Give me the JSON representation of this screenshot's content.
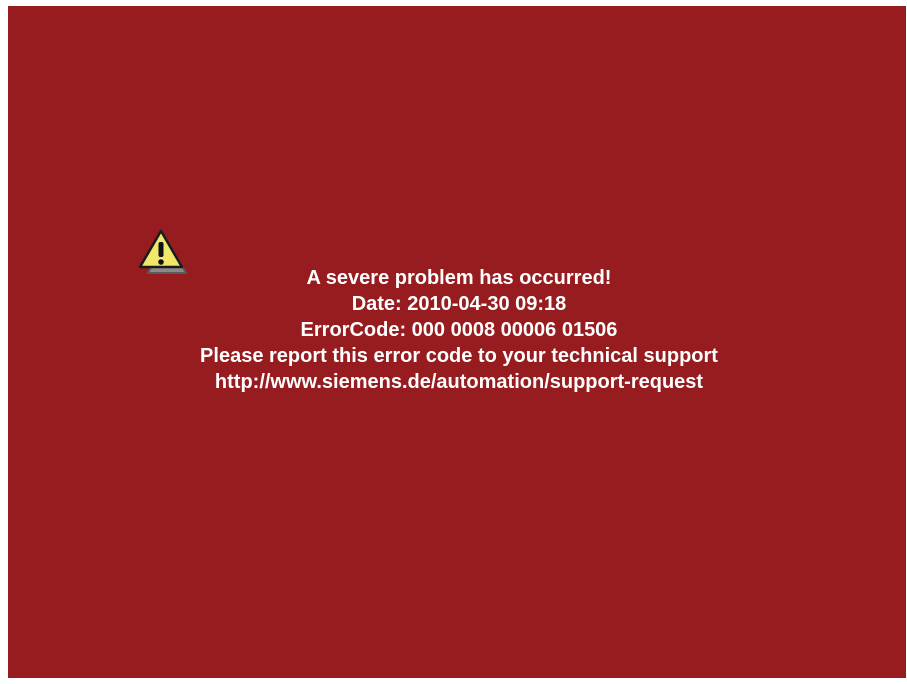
{
  "screen": {
    "background_color": "#961c1f",
    "text_color": "#ffffff",
    "icon": "warning-icon"
  },
  "error": {
    "headline": "A severe problem has occurred!",
    "date": "Date: 2010-04-30 09:18",
    "error_code": "ErrorCode: 000 0008 00006 01506",
    "instruction": "Please report this error code to your technical support",
    "support_url": "http://www.siemens.de/automation/support-request"
  }
}
